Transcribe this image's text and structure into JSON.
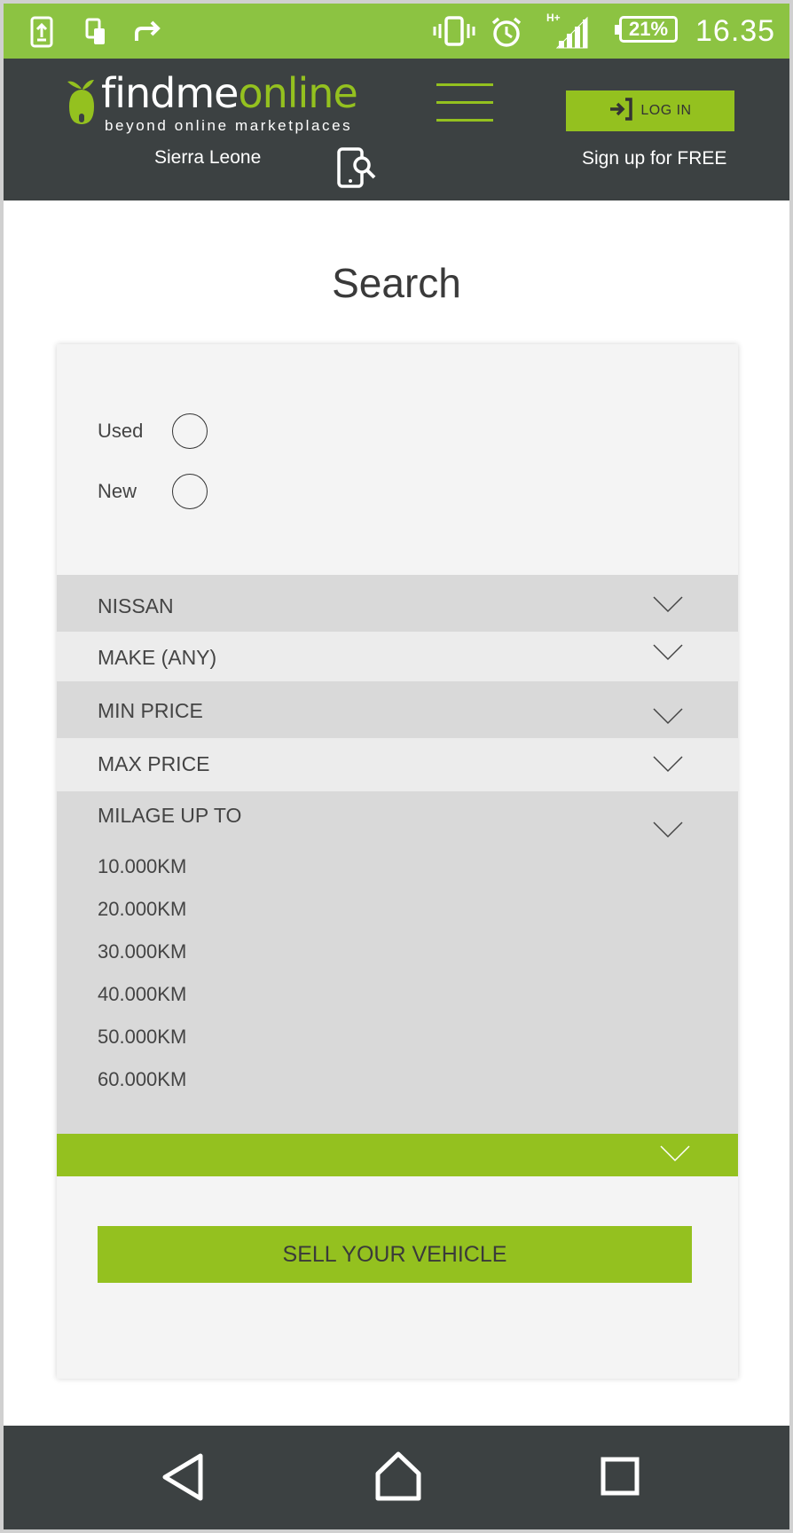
{
  "status_bar": {
    "battery": "21%",
    "time": "16.35",
    "network": "H+",
    "icons": [
      "screen-upload-icon",
      "phone-transfer-icon",
      "share-forward-icon",
      "vibrate-icon",
      "alarm-icon",
      "signal-icon",
      "battery-icon"
    ]
  },
  "header": {
    "logo_part1": "findme",
    "logo_part2": "online",
    "tagline": "beyond online marketplaces",
    "region": "Sierra Leone",
    "login_label": "LOG IN",
    "signup_label": "Sign up for FREE",
    "icons": [
      "logo-fruit-icon",
      "hamburger-menu-icon",
      "phone-search-icon",
      "login-arrow-icon"
    ]
  },
  "page": {
    "title": "Search"
  },
  "filters": {
    "condition": [
      {
        "label": "Used"
      },
      {
        "label": "New"
      }
    ],
    "dropdowns": [
      {
        "label": "NISSAN"
      },
      {
        "label": "MAKE (ANY)"
      },
      {
        "label": "MIN PRICE"
      },
      {
        "label": "MAX PRICE"
      },
      {
        "label": "MILAGE UP TO"
      }
    ],
    "milage_options": [
      "10.000KM",
      "20.000KM",
      "30.000KM",
      "40.000KM",
      "50.000KM",
      "60.000KM"
    ],
    "sell_button": "SELL YOUR VEHICLE"
  },
  "nav_bar": {
    "icons": [
      "back-icon",
      "home-icon",
      "recents-icon"
    ]
  },
  "colors": {
    "brand_green": "#94c11f",
    "status_green": "#8cc342",
    "dark_gray": "#3c4142"
  }
}
